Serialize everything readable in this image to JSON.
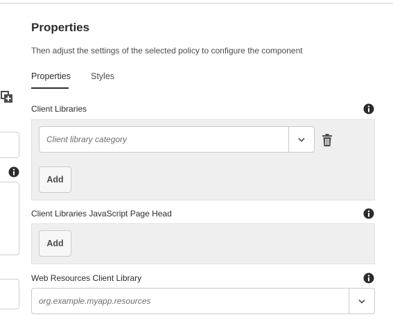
{
  "panel": {
    "title": "Properties",
    "description": "Then adjust the settings of the selected policy to configure the component"
  },
  "tabs": [
    {
      "label": "Properties",
      "selected": true
    },
    {
      "label": "Styles",
      "selected": false
    }
  ],
  "fields": {
    "client_libraries": {
      "label": "Client Libraries",
      "items": [
        {
          "placeholder": "Client library category",
          "value": ""
        }
      ],
      "add_label": "Add"
    },
    "client_libraries_js_head": {
      "label": "Client Libraries JavaScript Page Head",
      "add_label": "Add"
    },
    "web_resources": {
      "label": "Web Resources Client Library",
      "placeholder": "org.example.myapp.resources",
      "value": ""
    }
  },
  "icons": {
    "info": "info-icon",
    "delete": "trash-icon",
    "dropdown": "chevron-down-icon",
    "add_policy": "add-policy-icon"
  },
  "colors": {
    "text": "#2c2c2c",
    "muted_text": "#4b4b4b",
    "multifield_bg": "#efefef",
    "border": "#cacaca"
  }
}
